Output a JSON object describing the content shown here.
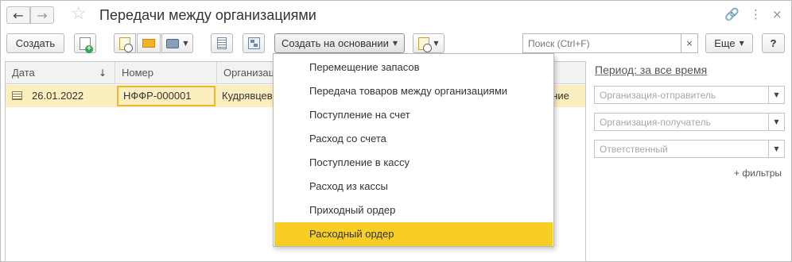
{
  "window": {
    "title": "Передачи между организациями",
    "nav_back": "←",
    "nav_forward": "→",
    "star": "☆",
    "link_icon": "🔗",
    "more_icon": "⋮",
    "close_icon": "×"
  },
  "toolbar": {
    "create_label": "Создать",
    "create_based_label": "Создать на основании",
    "caret": "▼",
    "search_placeholder": "Поиск (Ctrl+F)",
    "search_clear": "×",
    "more_label": "Еще",
    "help_label": "?"
  },
  "table": {
    "columns": [
      "Дата",
      "Номер",
      "Организаци"
    ],
    "sort_arrow": "↓",
    "rows": [
      {
        "date": "26.01.2022",
        "number": "НФФР-000001",
        "organization": "Кудрявцев",
        "tail": "ение"
      }
    ]
  },
  "menu": {
    "items": [
      "Перемещение запасов",
      "Передача товаров между организациями",
      "Поступление на счет",
      "Расход со счета",
      "Поступление в кассу",
      "Расход из кассы",
      "Приходный ордер",
      "Расходный ордер"
    ],
    "active_index": 7
  },
  "filters_panel": {
    "period_label": "Период: за все время",
    "sender_placeholder": "Организация-отправитель",
    "receiver_placeholder": "Организация-получатель",
    "responsible_placeholder": "Ответственный",
    "dd": "▼",
    "more_filters": "+ фильтры"
  },
  "colors": {
    "accent_yellow": "#f8cd24",
    "row_highlight": "#fbefc0",
    "cell_border": "#f2b532"
  }
}
